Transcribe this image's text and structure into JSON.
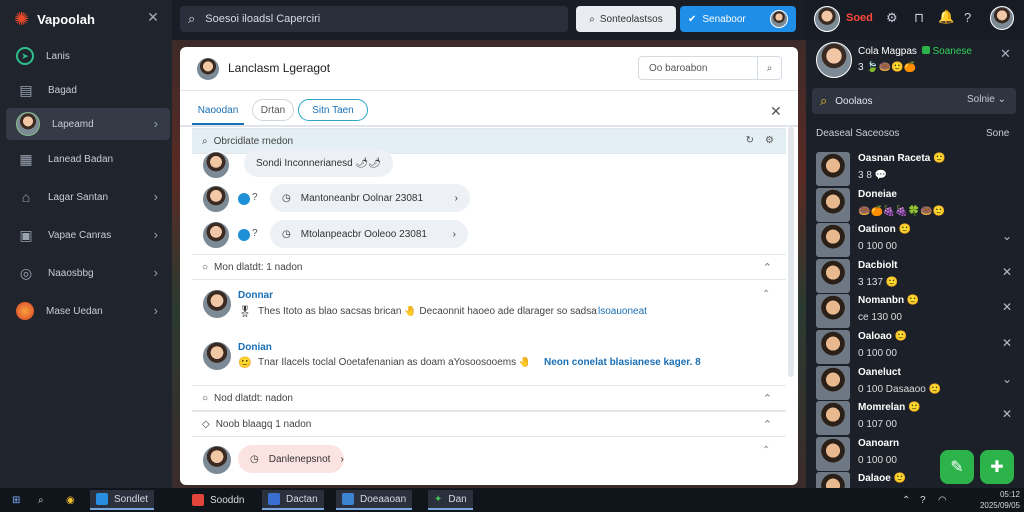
{
  "sidebar": {
    "brand": "Vapoolah",
    "items": [
      {
        "label": "Lanis",
        "icon": "compass-icon",
        "chevron": false
      },
      {
        "label": "Bagad",
        "icon": "inbox-icon",
        "chevron": false
      },
      {
        "label": "Lapeamd",
        "icon": "avatar",
        "chevron": true,
        "active": true
      },
      {
        "label": "Lanead Badan",
        "icon": "store-icon",
        "chevron": false
      },
      {
        "label": "Lagar Santan",
        "icon": "home-icon",
        "chevron": true
      },
      {
        "label": "Vapae Canras",
        "icon": "calendar-icon",
        "chevron": true
      },
      {
        "label": "Naaosbbg",
        "icon": "globe-icon",
        "chevron": true
      },
      {
        "label": "Mase Uedan",
        "icon": "fire-icon",
        "chevron": true
      }
    ]
  },
  "topbar": {
    "search": "Soesoi iloadsl Caperciri",
    "secondary_button": "Sonteolastsos",
    "primary_button": "Senaboor"
  },
  "top_right": {
    "alert_text": "Soed"
  },
  "modal": {
    "title": "Lanclasm Lgeragot",
    "search_text": "Oo baroabon",
    "tabs": [
      "Naoodan",
      "Drtan",
      "Sitn Taen"
    ],
    "sections": {
      "s1": "Obrcidlate rnedon",
      "s2": "Mon dlatdt: 1 nadon",
      "s3": "Nod dlatdt: nadon",
      "s4": "Noob blaagq 1 nadon"
    },
    "pills": {
      "p1": "Sondi Inconnerianesd 🌶🌶",
      "p2": "Mantoneanbr Oolnar 23081",
      "p3": "Mtolanpeacbr Ooleoo 23081"
    },
    "posts": [
      {
        "name": "Donnar",
        "text": "Thes Itoto as blao sacsas brican 🤚 Decaonnit haoeo ade dlarager so sadsa",
        "link": "lsoauoneat"
      },
      {
        "name": "Donian",
        "text": "Tnar Ilacels toclal Ooetafenanian as doam aYosoosooems 🤚",
        "link": "Neon conelat blasianese kager. 8"
      }
    ],
    "bottom_pill": "Danlenepsnot"
  },
  "rpanel": {
    "name": "Cola Magpas",
    "status": "Soanese",
    "emoji_line": "3 🍃🍩🙂🍊",
    "search": "Ooolaos",
    "sort": "Solnie",
    "label": "Deaseal Saceosos",
    "label2": "Sone",
    "channels": [
      {
        "name": "Oasnan Raceta 🙂",
        "sub": "3 8 💬"
      },
      {
        "name": "Doneiae",
        "sub": "🍩🍊🍇🍇🍀🍩🙂"
      },
      {
        "name": "Oatinon 🙂",
        "sub": "0 100 00"
      },
      {
        "name": "Dacbiolt",
        "sub": "3 137 🙂"
      },
      {
        "name": "Nomanbn 🙂",
        "sub": "ce 130 00"
      },
      {
        "name": "Oaloao 🙂",
        "sub": "0 100 00"
      },
      {
        "name": "Oaneluct",
        "sub": "0 100 Dasaaoo 🙂"
      },
      {
        "name": "Momrelan 🙂",
        "sub": "0 107 00"
      },
      {
        "name": "Oanoarn",
        "sub": "0 100 00"
      },
      {
        "name": "Dalaoe 🙂",
        "sub": ""
      }
    ]
  },
  "taskbar": {
    "items": [
      "Sondlet",
      "Sooddn",
      "Dactan",
      "Doeaaoan",
      "Dan"
    ],
    "time": "05:12",
    "date": "2025/09/05"
  },
  "colors": {
    "accent": "#1f8ee8",
    "green": "#2cb34a",
    "sidebar": "#1f242d"
  }
}
